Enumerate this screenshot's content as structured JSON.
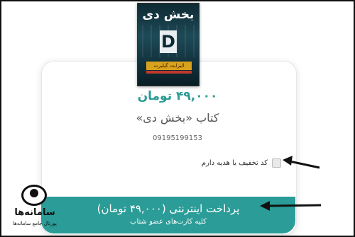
{
  "product": {
    "cover_title": "بخش دی",
    "cover_letter": "D",
    "cover_author": "الیزابت گیلبرت",
    "price": "۴۹,۰۰۰ تومان",
    "name": "کتاب «بخش دی»",
    "phone": "09195199153"
  },
  "discount": {
    "label": "کد تخفیف یا هدیه دارم",
    "checked": false
  },
  "payment": {
    "button_label": "پرداخت اینترنتی (۴۹,۰۰۰ تومان)",
    "subtext": "کلیه کارت‌های عضو شتاب"
  },
  "watermark": {
    "brand": "سامانه‌ها",
    "tagline": "پورتال جامع سامانه‌ها"
  },
  "colors": {
    "accent": "#2b9c97",
    "price": "#2a9c96"
  }
}
